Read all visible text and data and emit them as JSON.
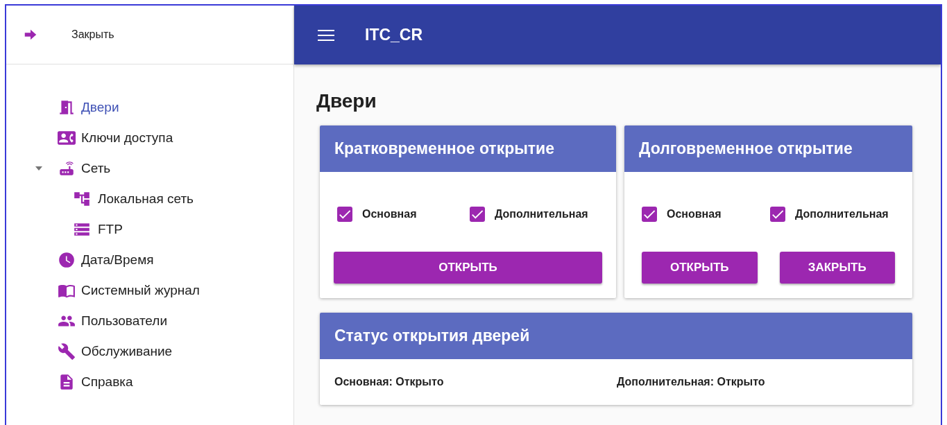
{
  "drawer": {
    "close_label": "Закрыть",
    "items": [
      {
        "label": "Двери",
        "selected": true
      },
      {
        "label": "Ключи доступа",
        "selected": false
      },
      {
        "label": "Сеть",
        "selected": false,
        "expanded": true,
        "children": [
          {
            "label": "Локальная сеть",
            "selected": false
          },
          {
            "label": "FTP",
            "selected": false
          }
        ]
      },
      {
        "label": "Дата/Время",
        "selected": false
      },
      {
        "label": "Системный журнал",
        "selected": false
      },
      {
        "label": "Пользователи",
        "selected": false
      },
      {
        "label": "Обслуживание",
        "selected": false
      },
      {
        "label": "Справка",
        "selected": false
      }
    ]
  },
  "app_bar": {
    "title": "ITC_CR"
  },
  "page": {
    "title": "Двери"
  },
  "cards": [
    {
      "kind": "action",
      "title": "Кратковременное открытие",
      "checkboxes": [
        {
          "label": "Основная",
          "checked": true
        },
        {
          "label": "Дополнительная",
          "checked": true
        }
      ],
      "buttons": [
        "ОТКРЫТЬ"
      ]
    },
    {
      "kind": "action",
      "title": "Долговременное открытие",
      "checkboxes": [
        {
          "label": "Основная",
          "checked": true
        },
        {
          "label": "Дополнительная",
          "checked": true
        }
      ],
      "buttons": [
        "ОТКРЫТЬ",
        "ЗАКРЫТЬ"
      ]
    },
    {
      "kind": "status",
      "title": "Статус открытия дверей",
      "items": [
        "Основная: Открыто",
        "Дополнительная: Открыто"
      ]
    }
  ]
}
